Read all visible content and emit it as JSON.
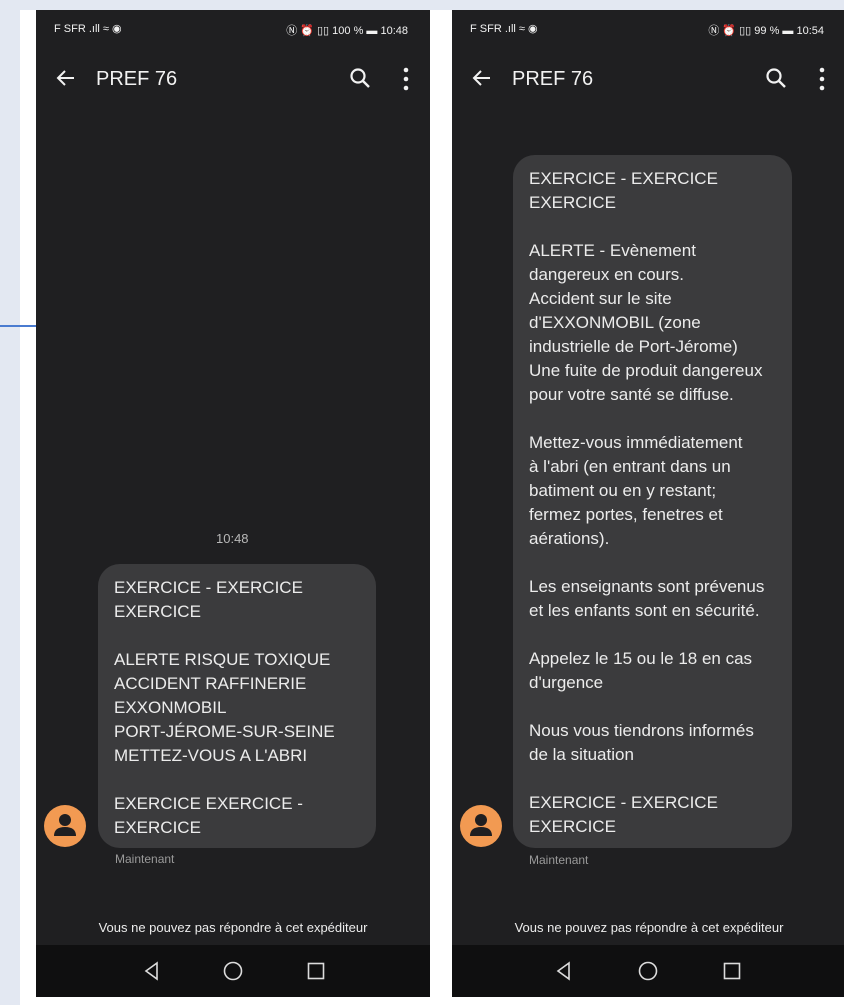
{
  "phone_left": {
    "status": {
      "left": "F SFR .ıll ≈ ◉",
      "right": "Ⓝ ⏰ ▯▯ 100 % ▬ 10:48"
    },
    "title": "PREF 76",
    "timestamp": "10:48",
    "message": [
      "EXERCICE - EXERCICE\nEXERCICE",
      "ALERTE RISQUE TOXIQUE\nACCIDENT RAFFINERIE\nEXXONMOBIL\nPORT-JÉROME-SUR-SEINE\nMETTEZ-VOUS A L'ABRI",
      "EXERCICE  EXERCICE -\nEXERCICE"
    ],
    "subtext": "Maintenant",
    "notice": "Vous ne pouvez pas répondre à cet expéditeur"
  },
  "phone_right": {
    "status": {
      "left": "F SFR .ıll ≈ ◉",
      "right": "Ⓝ ⏰ ▯▯ 99 % ▬ 10:54"
    },
    "title": "PREF 76",
    "message": [
      "EXERCICE - EXERCICE\nEXERCICE",
      "ALERTE - Evènement\ndangereux en cours.\nAccident sur le site\nd'EXXONMOBIL (zone\nindustrielle de Port-Jérome)\nUne fuite de produit dangereux\npour votre santé se diffuse.",
      "Mettez-vous immédiatement\nà l'abri (en entrant dans un\nbatiment ou en y restant;\nfermez portes, fenetres et\naérations).",
      "Les enseignants sont prévenus\net les enfants sont en sécurité.",
      "Appelez le 15 ou le 18 en cas\nd'urgence",
      "Nous vous tiendrons informés\nde la situation",
      "EXERCICE - EXERCICE\nEXERCICE"
    ],
    "subtext": "Maintenant",
    "notice": "Vous ne pouvez pas répondre à cet expéditeur"
  },
  "icons": [
    "back-arrow-icon",
    "search-icon",
    "more-vert-icon",
    "person-icon",
    "nav-back-icon",
    "nav-home-icon",
    "nav-recents-icon"
  ],
  "colors": {
    "background": "#1f1f21",
    "bubble": "#3b3b3d",
    "avatar": "#f29a52"
  }
}
